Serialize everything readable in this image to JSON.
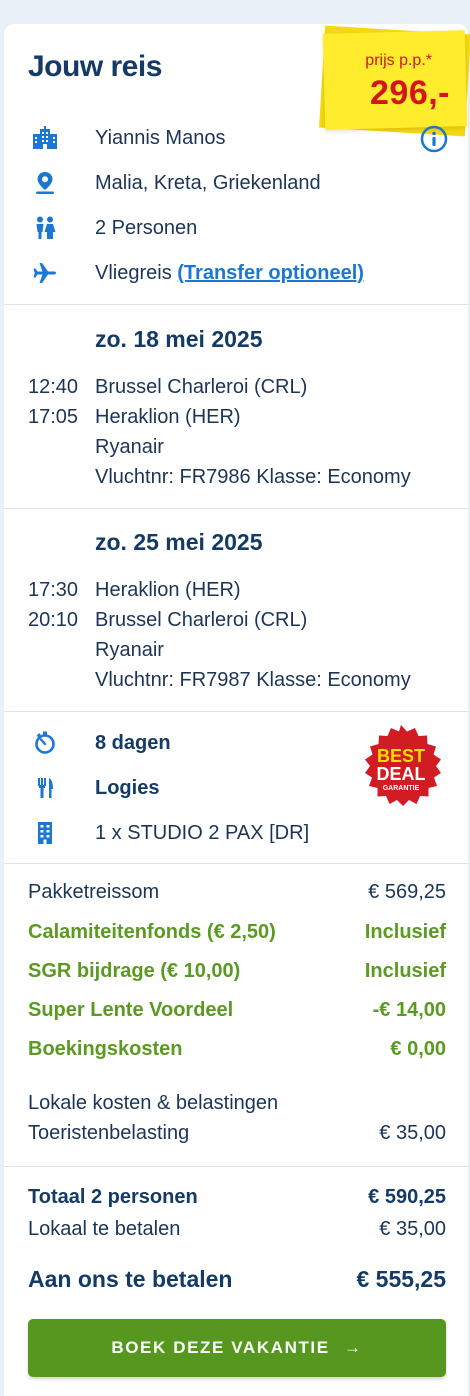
{
  "header": {
    "title": "Jouw reis",
    "price_label": "prijs p.p.*",
    "price": "296,-"
  },
  "trip": {
    "hotel": "Yiannis Manos",
    "location": "Malia, Kreta, Griekenland",
    "persons": "2 Personen",
    "travel_type": "Vliegreis",
    "transfer_link": "(Transfer optioneel)"
  },
  "flights": [
    {
      "date": "zo. 18 mei 2025",
      "dep_time": "12:40",
      "dep_airport": "Brussel Charleroi (CRL)",
      "arr_time": "17:05",
      "arr_airport": "Heraklion (HER)",
      "airline": "Ryanair",
      "flight_info": "Vluchtnr: FR7986 Klasse: Economy"
    },
    {
      "date": "zo. 25 mei 2025",
      "dep_time": "17:30",
      "dep_airport": "Heraklion (HER)",
      "arr_time": "20:10",
      "arr_airport": "Brussel Charleroi (CRL)",
      "airline": "Ryanair",
      "flight_info": "Vluchtnr: FR7987 Klasse: Economy"
    }
  ],
  "stay": {
    "duration": "8 dagen",
    "board": "Logies",
    "room": "1 x STUDIO 2 PAX [DR]",
    "badge_line1": "BEST",
    "badge_line2": "DEAL",
    "badge_line3": "GARANTIE"
  },
  "pricing": [
    {
      "label": "Pakketreissom",
      "value": "€ 569,25"
    },
    {
      "label": "Calamiteitenfonds (€ 2,50)",
      "value": "Inclusief"
    },
    {
      "label": "SGR bijdrage (€ 10,00)",
      "value": "Inclusief"
    },
    {
      "label": "Super Lente Voordeel",
      "value": "-€ 14,00"
    },
    {
      "label": "Boekingskosten",
      "value": "€ 0,00"
    }
  ],
  "local_costs": {
    "heading": "Lokale kosten & belastingen",
    "tourist_tax_label": "Toeristenbelasting",
    "tourist_tax_value": "€ 35,00"
  },
  "totals": {
    "total_label": "Totaal 2 personen",
    "total_value": "€ 590,25",
    "local_label": "Lokaal te betalen",
    "local_value": "€ 35,00",
    "pay_label": "Aan ons te betalen",
    "pay_value": "€ 555,25"
  },
  "cta": {
    "label": "BOEK DEZE VAKANTIE",
    "arrow": "→"
  },
  "colors": {
    "navy": "#143a66",
    "blue_icon": "#1b77d2",
    "green": "#5b9a21",
    "price_red": "#d3161b",
    "sticker_yellow": "#ffed2d",
    "button_green": "#56981f"
  }
}
